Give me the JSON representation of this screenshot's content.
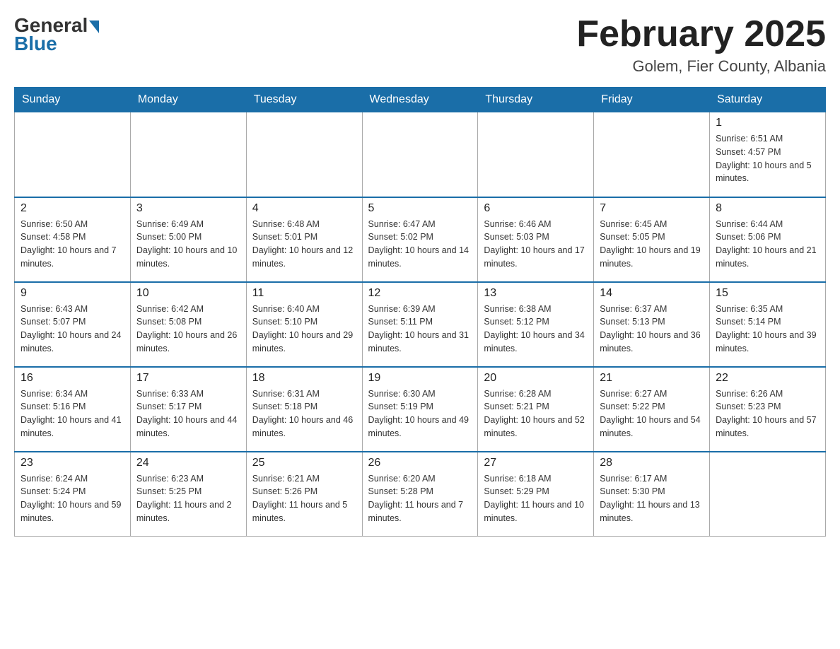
{
  "logo": {
    "general": "General",
    "blue": "Blue"
  },
  "title": "February 2025",
  "subtitle": "Golem, Fier County, Albania",
  "days_of_week": [
    "Sunday",
    "Monday",
    "Tuesday",
    "Wednesday",
    "Thursday",
    "Friday",
    "Saturday"
  ],
  "weeks": [
    [
      {
        "day": "",
        "info": ""
      },
      {
        "day": "",
        "info": ""
      },
      {
        "day": "",
        "info": ""
      },
      {
        "day": "",
        "info": ""
      },
      {
        "day": "",
        "info": ""
      },
      {
        "day": "",
        "info": ""
      },
      {
        "day": "1",
        "info": "Sunrise: 6:51 AM\nSunset: 4:57 PM\nDaylight: 10 hours and 5 minutes."
      }
    ],
    [
      {
        "day": "2",
        "info": "Sunrise: 6:50 AM\nSunset: 4:58 PM\nDaylight: 10 hours and 7 minutes."
      },
      {
        "day": "3",
        "info": "Sunrise: 6:49 AM\nSunset: 5:00 PM\nDaylight: 10 hours and 10 minutes."
      },
      {
        "day": "4",
        "info": "Sunrise: 6:48 AM\nSunset: 5:01 PM\nDaylight: 10 hours and 12 minutes."
      },
      {
        "day": "5",
        "info": "Sunrise: 6:47 AM\nSunset: 5:02 PM\nDaylight: 10 hours and 14 minutes."
      },
      {
        "day": "6",
        "info": "Sunrise: 6:46 AM\nSunset: 5:03 PM\nDaylight: 10 hours and 17 minutes."
      },
      {
        "day": "7",
        "info": "Sunrise: 6:45 AM\nSunset: 5:05 PM\nDaylight: 10 hours and 19 minutes."
      },
      {
        "day": "8",
        "info": "Sunrise: 6:44 AM\nSunset: 5:06 PM\nDaylight: 10 hours and 21 minutes."
      }
    ],
    [
      {
        "day": "9",
        "info": "Sunrise: 6:43 AM\nSunset: 5:07 PM\nDaylight: 10 hours and 24 minutes."
      },
      {
        "day": "10",
        "info": "Sunrise: 6:42 AM\nSunset: 5:08 PM\nDaylight: 10 hours and 26 minutes."
      },
      {
        "day": "11",
        "info": "Sunrise: 6:40 AM\nSunset: 5:10 PM\nDaylight: 10 hours and 29 minutes."
      },
      {
        "day": "12",
        "info": "Sunrise: 6:39 AM\nSunset: 5:11 PM\nDaylight: 10 hours and 31 minutes."
      },
      {
        "day": "13",
        "info": "Sunrise: 6:38 AM\nSunset: 5:12 PM\nDaylight: 10 hours and 34 minutes."
      },
      {
        "day": "14",
        "info": "Sunrise: 6:37 AM\nSunset: 5:13 PM\nDaylight: 10 hours and 36 minutes."
      },
      {
        "day": "15",
        "info": "Sunrise: 6:35 AM\nSunset: 5:14 PM\nDaylight: 10 hours and 39 minutes."
      }
    ],
    [
      {
        "day": "16",
        "info": "Sunrise: 6:34 AM\nSunset: 5:16 PM\nDaylight: 10 hours and 41 minutes."
      },
      {
        "day": "17",
        "info": "Sunrise: 6:33 AM\nSunset: 5:17 PM\nDaylight: 10 hours and 44 minutes."
      },
      {
        "day": "18",
        "info": "Sunrise: 6:31 AM\nSunset: 5:18 PM\nDaylight: 10 hours and 46 minutes."
      },
      {
        "day": "19",
        "info": "Sunrise: 6:30 AM\nSunset: 5:19 PM\nDaylight: 10 hours and 49 minutes."
      },
      {
        "day": "20",
        "info": "Sunrise: 6:28 AM\nSunset: 5:21 PM\nDaylight: 10 hours and 52 minutes."
      },
      {
        "day": "21",
        "info": "Sunrise: 6:27 AM\nSunset: 5:22 PM\nDaylight: 10 hours and 54 minutes."
      },
      {
        "day": "22",
        "info": "Sunrise: 6:26 AM\nSunset: 5:23 PM\nDaylight: 10 hours and 57 minutes."
      }
    ],
    [
      {
        "day": "23",
        "info": "Sunrise: 6:24 AM\nSunset: 5:24 PM\nDaylight: 10 hours and 59 minutes."
      },
      {
        "day": "24",
        "info": "Sunrise: 6:23 AM\nSunset: 5:25 PM\nDaylight: 11 hours and 2 minutes."
      },
      {
        "day": "25",
        "info": "Sunrise: 6:21 AM\nSunset: 5:26 PM\nDaylight: 11 hours and 5 minutes."
      },
      {
        "day": "26",
        "info": "Sunrise: 6:20 AM\nSunset: 5:28 PM\nDaylight: 11 hours and 7 minutes."
      },
      {
        "day": "27",
        "info": "Sunrise: 6:18 AM\nSunset: 5:29 PM\nDaylight: 11 hours and 10 minutes."
      },
      {
        "day": "28",
        "info": "Sunrise: 6:17 AM\nSunset: 5:30 PM\nDaylight: 11 hours and 13 minutes."
      },
      {
        "day": "",
        "info": ""
      }
    ]
  ]
}
